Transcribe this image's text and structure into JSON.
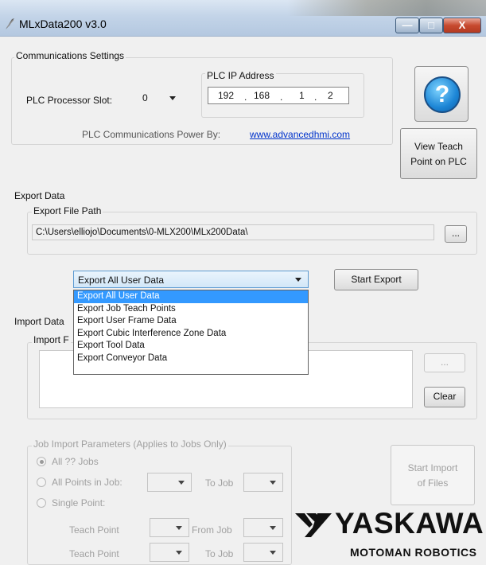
{
  "window": {
    "title": "MLxData200 v3.0",
    "buttons": {
      "minimize": "—",
      "maximize": "□",
      "close": "X"
    }
  },
  "comm": {
    "group_label": "Communications Settings",
    "slot_label": "PLC Processor Slot:",
    "slot_value": "0",
    "ip_label": "PLC IP Address",
    "ip": [
      "192",
      "168",
      "1",
      "2"
    ],
    "ip_dots": ".",
    "power_text": "PLC Communications Power By:",
    "power_link": "www.advancedhmi.com"
  },
  "help_button": "?",
  "view_teach_button": "View Teach Point on PLC",
  "export": {
    "section_label": "Export Data",
    "path_label": "Export File Path",
    "path_value": "C:\\Users\\elliojo\\Documents\\0-MLX200\\MLx200Data\\",
    "browse_label": "...",
    "selected": "Export All User Data",
    "start_button": "Start Export",
    "options": [
      "Export All User Data",
      "Export Job Teach Points",
      "Export User Frame Data",
      "Export Cubic Interference Zone Data",
      "Export Tool Data",
      "Export Conveyor Data"
    ]
  },
  "import": {
    "section_label": "Import Data",
    "files_label": "Import F",
    "browse_label": "...",
    "clear_button": "Clear",
    "params_label": "Job Import Parameters (Applies to Jobs Only)",
    "radio_all": "All ?? Jobs",
    "radio_points": "All Points in Job:",
    "to_job": "To Job",
    "radio_single": "Single Point:",
    "teach_point": "Teach Point",
    "from_job": "From Job",
    "start_import": "Start Import of Files"
  },
  "logo": {
    "brand": "YASKAWA",
    "sub": "MOTOMAN ROBOTICS"
  }
}
